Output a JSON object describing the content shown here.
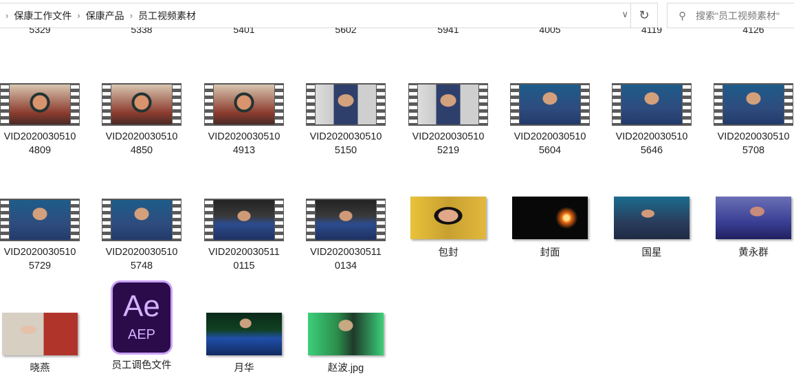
{
  "breadcrumb": [
    "保康工作文件",
    "保康产品",
    "员工视频素材"
  ],
  "search": {
    "placeholder": "搜索\"员工视频素材\""
  },
  "cut_labels": [
    "5329",
    "5338",
    "5401",
    "5602",
    "5941",
    "4005",
    "4119",
    "4126"
  ],
  "items": [
    {
      "l1": "VID2020030510",
      "l2": "4809",
      "kind": "film",
      "p": "p1"
    },
    {
      "l1": "VID2020030510",
      "l2": "4850",
      "kind": "film",
      "p": "p1"
    },
    {
      "l1": "VID2020030510",
      "l2": "4913",
      "kind": "film",
      "p": "p1"
    },
    {
      "l1": "VID2020030510",
      "l2": "5150",
      "kind": "film",
      "p": "p2"
    },
    {
      "l1": "VID2020030510",
      "l2": "5219",
      "kind": "film",
      "p": "p2"
    },
    {
      "l1": "VID2020030510",
      "l2": "5604",
      "kind": "film",
      "p": "p3"
    },
    {
      "l1": "VID2020030510",
      "l2": "5646",
      "kind": "film",
      "p": "p3"
    },
    {
      "l1": "VID2020030510",
      "l2": "5708",
      "kind": "film",
      "p": "p3"
    },
    {
      "l1": "VID2020030510",
      "l2": "5729",
      "kind": "film",
      "p": "p3"
    },
    {
      "l1": "VID2020030510",
      "l2": "5748",
      "kind": "film",
      "p": "p3"
    },
    {
      "l1": "VID2020030511",
      "l2": "0115",
      "kind": "film",
      "p": "p4"
    },
    {
      "l1": "VID2020030511",
      "l2": "0134",
      "kind": "film",
      "p": "p4"
    },
    {
      "l1": "包封",
      "kind": "img",
      "bg": "radial-gradient(ellipse at 50% 45%,#e0a888 0 14px,#111 15px 20px,transparent 21px),linear-gradient(90deg,#e9c23a,#c8a030 50%,#e2b83c)"
    },
    {
      "l1": "封面",
      "kind": "img",
      "bg": "radial-gradient(circle at 72% 50%,#ffe08a 0 4px,#f06a12 7px,transparent 16px),#080808"
    },
    {
      "l1": "国星",
      "kind": "img",
      "bg": "radial-gradient(ellipse at 45% 40%,#d29a7a 0 9px,transparent 10px),linear-gradient(#1b6d8f,#2a3c5c 60%,#1e2a44)"
    },
    {
      "l1": "黄永群",
      "kind": "img",
      "bg": "radial-gradient(ellipse at 55% 35%,#c98c7a 0 10px,transparent 11px),linear-gradient(#6b6fb5,#3a3f94 60%,#202060)"
    },
    {
      "l1": "晓燕",
      "kind": "img",
      "bg": "radial-gradient(ellipse at 35% 40%,#e6c0a8 0 11px,transparent 12px),linear-gradient(90deg,#d8cfc3 55%,#b0342a 55%)"
    },
    {
      "l1": "员工调色文件",
      "kind": "ae",
      "a": "Ae",
      "b": "AEP"
    },
    {
      "l1": "月华",
      "kind": "img",
      "bg": "radial-gradient(ellipse at 52% 25%,#caa080 0 8px,transparent 9px),linear-gradient(#0b2a1a,#104020 40%,#1f4fa8 60%,#122a60)"
    },
    {
      "l1": "赵波.jpg",
      "kind": "img",
      "bg": "radial-gradient(ellipse at 50% 30%,#c6a882 0 10px,transparent 11px),linear-gradient(90deg,#3cd07a,#2a8a4a 40%,#1f3a2a 60%,#3cd07a)"
    }
  ]
}
